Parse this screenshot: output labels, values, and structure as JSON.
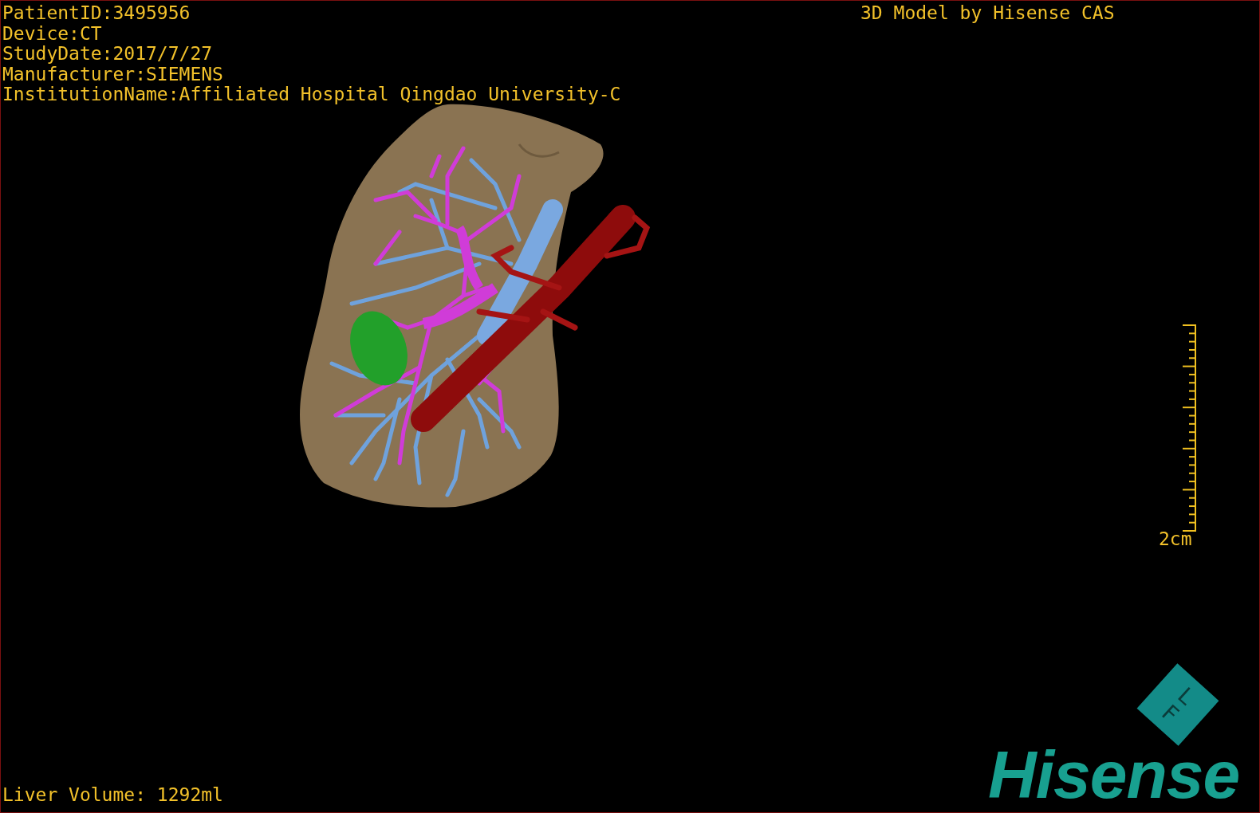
{
  "info_lines": [
    "PatientID:3495956",
    "Device:CT",
    "StudyDate:2017/7/27",
    "Manufacturer:SIEMENS",
    "InstitutionName:Affiliated Hospital Qingdao University-C"
  ],
  "title": "3D Model by Hisense CAS",
  "scale_bar": {
    "label": "2cm"
  },
  "orientation_cube": {
    "labels": [
      "F",
      "L"
    ]
  },
  "logo": "Hisense",
  "liver_volume": "Liver Volume: 1292ml"
}
